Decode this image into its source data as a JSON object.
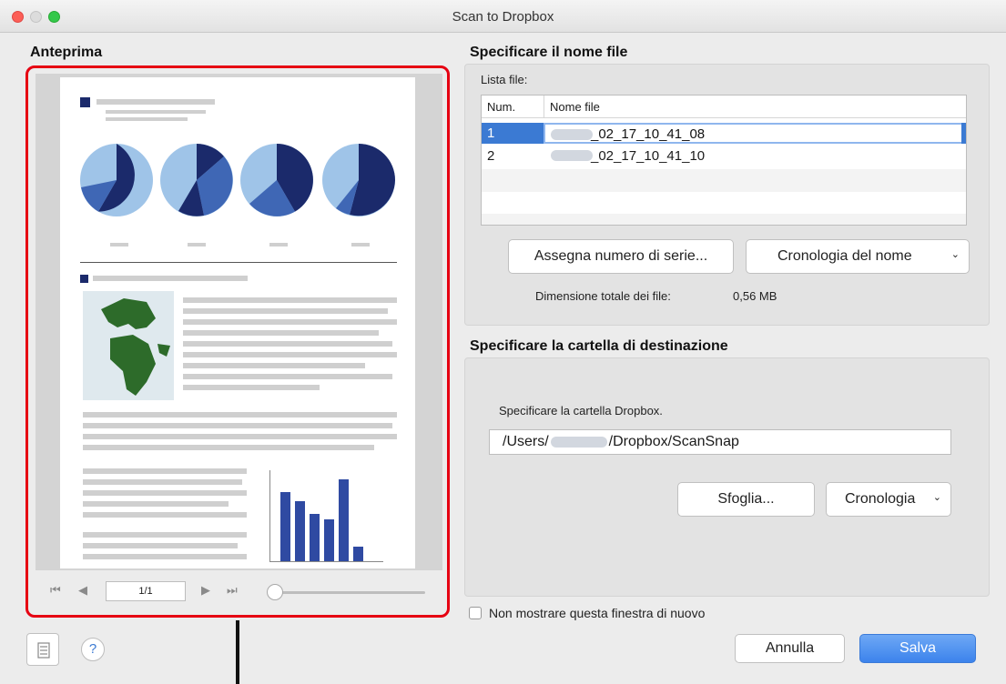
{
  "window": {
    "title": "Scan to Dropbox"
  },
  "preview": {
    "heading": "Anteprima",
    "page_field": "1/1",
    "nav": {
      "first_icon": "skip-first-icon",
      "prev_icon": "triangle-left-icon",
      "next_icon": "triangle-right-icon",
      "last_icon": "skip-last-icon"
    }
  },
  "file_name_section": {
    "heading": "Specificare il nome file",
    "list_label": "Lista file:",
    "columns": [
      "Num.",
      "Nome file"
    ],
    "rows": [
      {
        "num": "1",
        "name": "_02_17_10_41_08",
        "selected": true
      },
      {
        "num": "2",
        "name": "_02_17_10_41_10",
        "selected": false
      }
    ],
    "serial_button": "Assegna numero di serie...",
    "name_history_select": "Cronologia del nome",
    "total_size_label": "Dimensione totale dei file:",
    "total_size_value": "0,56  MB"
  },
  "destination_section": {
    "heading": "Specificare la cartella di destinazione",
    "folder_label": "Specificare la cartella Dropbox.",
    "path_prefix": "/Users/",
    "path_suffix": "/Dropbox/ScanSnap",
    "browse_button": "Sfoglia...",
    "history_select": "Cronologia"
  },
  "footer": {
    "dont_show_label": "Non mostrare questa finestra di nuovo",
    "cancel_button": "Annulla",
    "save_button": "Salva",
    "help_glyph": "?"
  },
  "colors": {
    "accent": "#3b7ad3",
    "highlight_border": "#e60012",
    "chart_dark": "#1b2a6b",
    "chart_mid": "#3f67b5",
    "chart_light": "#9fc4e8",
    "map_green": "#2d6b2a"
  }
}
